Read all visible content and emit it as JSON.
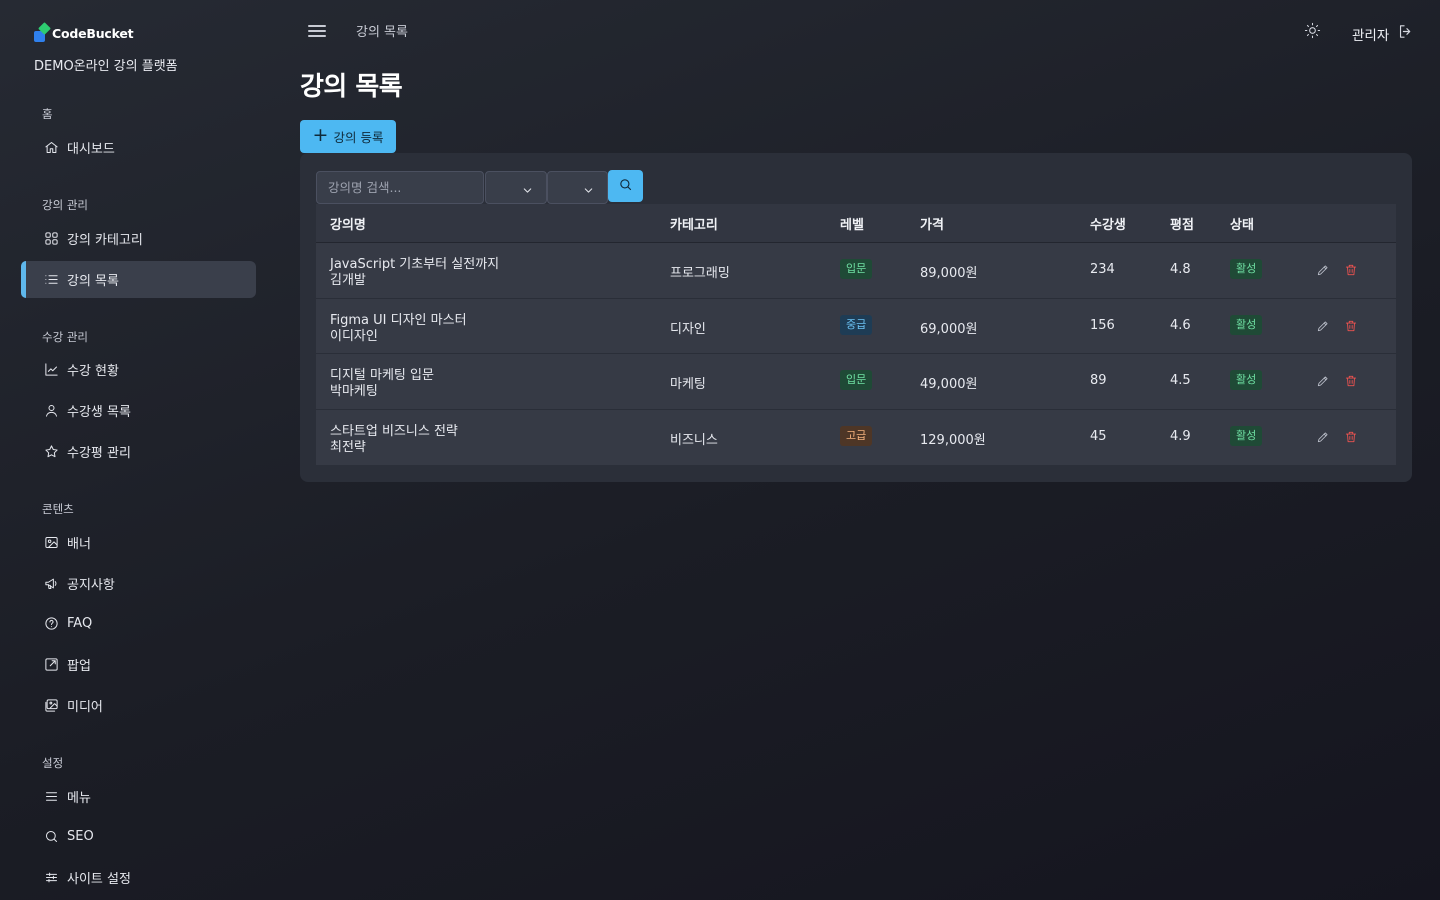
{
  "brand": {
    "name": "CodeBucket",
    "subtitle": "DEMO온라인 강의 플랫폼"
  },
  "sidebar": {
    "sections": [
      {
        "title": "홈",
        "items": [
          {
            "label": "대시보드",
            "icon": "home-icon"
          }
        ]
      },
      {
        "title": "강의 관리",
        "items": [
          {
            "label": "강의 카테고리",
            "icon": "grid-icon"
          },
          {
            "label": "강의 목록",
            "icon": "list-icon",
            "active": true
          }
        ]
      },
      {
        "title": "수강 관리",
        "items": [
          {
            "label": "수강 현황",
            "icon": "chart-line-icon"
          },
          {
            "label": "수강생 목록",
            "icon": "user-icon"
          },
          {
            "label": "수강평 관리",
            "icon": "star-icon"
          }
        ]
      },
      {
        "title": "콘텐츠",
        "items": [
          {
            "label": "배너",
            "icon": "image-icon"
          },
          {
            "label": "공지사항",
            "icon": "megaphone-icon"
          },
          {
            "label": "FAQ",
            "icon": "help-circle-icon"
          },
          {
            "label": "팝업",
            "icon": "external-link-icon"
          },
          {
            "label": "미디어",
            "icon": "images-icon"
          }
        ]
      },
      {
        "title": "설정",
        "items": [
          {
            "label": "메뉴",
            "icon": "menu-icon"
          },
          {
            "label": "SEO",
            "icon": "search-icon"
          },
          {
            "label": "사이트 설정",
            "icon": "sliders-icon"
          }
        ]
      }
    ]
  },
  "header": {
    "breadcrumb": "강의 목록",
    "user": "관리자"
  },
  "page": {
    "title": "강의 목록",
    "add_button": "강의 등록"
  },
  "filters": {
    "search_placeholder": "강의명 검색...",
    "category_value": "",
    "level_value": ""
  },
  "table": {
    "columns": [
      "강의명",
      "카테고리",
      "레벨",
      "가격",
      "수강생",
      "평점",
      "상태"
    ],
    "rows": [
      {
        "title": "JavaScript 기초부터 실전까지",
        "instructor": "김개발",
        "category": "프로그래밍",
        "level": "입문",
        "level_class": "lvl-intro",
        "price": "89,000원",
        "students": "234",
        "rating": "4.8",
        "status": "활성"
      },
      {
        "title": "Figma UI 디자인 마스터",
        "instructor": "이디자인",
        "category": "디자인",
        "level": "중급",
        "level_class": "lvl-mid",
        "price": "69,000원",
        "students": "156",
        "rating": "4.6",
        "status": "활성"
      },
      {
        "title": "디지털 마케팅 입문",
        "instructor": "박마케팅",
        "category": "마케팅",
        "level": "입문",
        "level_class": "lvl-intro",
        "price": "49,000원",
        "students": "89",
        "rating": "4.5",
        "status": "활성"
      },
      {
        "title": "스타트업 비즈니스 전략",
        "instructor": "최전략",
        "category": "비즈니스",
        "level": "고급",
        "level_class": "lvl-adv",
        "price": "129,000원",
        "students": "45",
        "rating": "4.9",
        "status": "활성"
      }
    ]
  },
  "colors": {
    "accent": "#4db8f2",
    "active_indicator": "#5fb8ec",
    "delete": "#ef5350",
    "status_active": "#6fe0a3"
  }
}
